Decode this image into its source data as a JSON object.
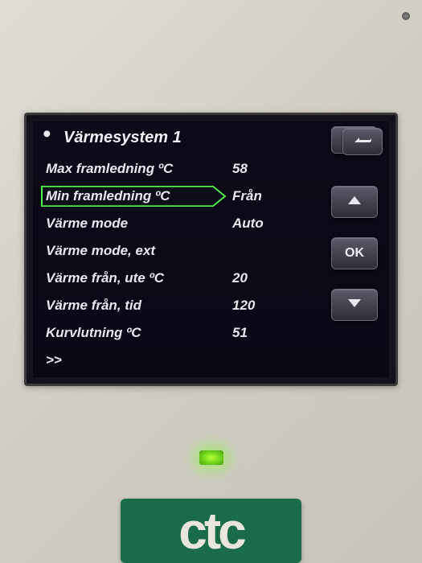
{
  "header": {
    "title": "Värmesystem 1"
  },
  "rows": [
    {
      "label": "Max framledning ºC",
      "value": "58",
      "selected": false
    },
    {
      "label": "Min framledning ºC",
      "value": "Från",
      "selected": true
    },
    {
      "label": "Värme mode",
      "value": "Auto",
      "selected": false
    },
    {
      "label": "Värme mode, ext",
      "value": "",
      "selected": false
    },
    {
      "label": "Värme från, ute ºC",
      "value": "20",
      "selected": false
    },
    {
      "label": "Värme från, tid",
      "value": "120",
      "selected": false
    },
    {
      "label": "Kurvlutning ºC",
      "value": "51",
      "selected": false
    }
  ],
  "more_indicator": ">>",
  "buttons": {
    "ok_label": "OK"
  },
  "brand": "ctc"
}
